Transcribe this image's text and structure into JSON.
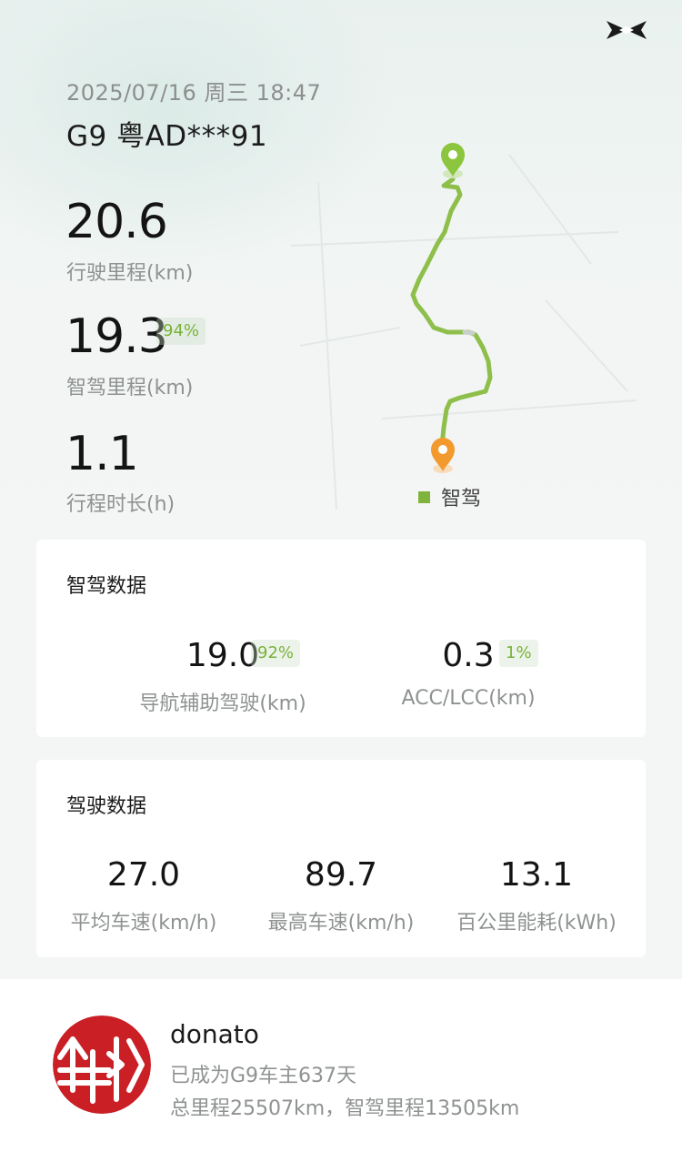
{
  "header": {
    "datetime": "2025/07/16 周三 18:47",
    "vehicle": "G9 粤AD***91",
    "logo_icon": "xpeng-logo-icon"
  },
  "summary": {
    "distance": {
      "value": "20.6",
      "label": "行驶里程(km)"
    },
    "smart_distance": {
      "value": "19.3",
      "label": "智驾里程(km)",
      "badge": "94%"
    },
    "duration": {
      "value": "1.1",
      "label": "行程时长(h)"
    }
  },
  "map": {
    "legend_label": "智驾",
    "route_color": "#8dbf4a",
    "start_marker_color": "#8cc63f",
    "end_marker_color": "#f39a2e"
  },
  "smart_drive": {
    "title": "智驾数据",
    "nav_assist": {
      "value": "19.0",
      "badge": "92%",
      "label": "导航辅助驾驶(km)"
    },
    "acc_lcc": {
      "value": "0.3",
      "badge": "1%",
      "label": "ACC/LCC(km)"
    }
  },
  "driving": {
    "title": "驾驶数据",
    "avg_speed": {
      "value": "27.0",
      "label": "平均车速(km/h)"
    },
    "max_speed": {
      "value": "89.7",
      "label": "最高车速(km/h)"
    },
    "energy": {
      "value": "13.1",
      "label": "百公里能耗(kWh)"
    }
  },
  "profile": {
    "username": "donato",
    "owner_days": "已成为G9车主637天",
    "totals": "总里程25507km，智驾里程13505km",
    "avatar_icon": "avatar-icon",
    "avatar_color": "#c91f25"
  }
}
